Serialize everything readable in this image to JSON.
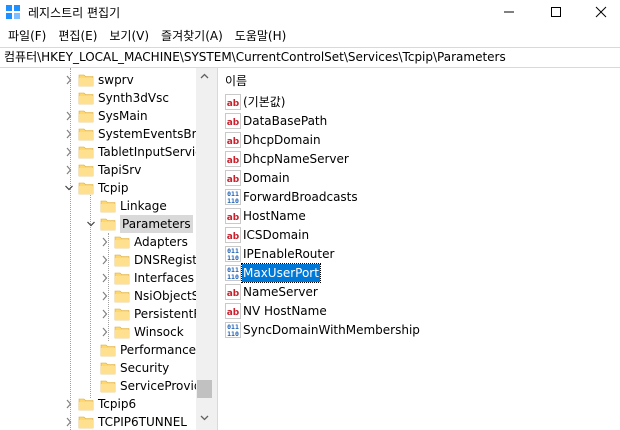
{
  "window": {
    "title": "레지스트리 편집기",
    "controls": [
      "minimize-icon",
      "maximize-icon",
      "close-icon"
    ]
  },
  "menu": [
    "파일(F)",
    "편집(E)",
    "보기(V)",
    "즐겨찾기(A)",
    "도움말(H)"
  ],
  "address": "컴퓨터\\HKEY_LOCAL_MACHINE\\SYSTEM\\CurrentControlSet\\Services\\Tcpip\\Parameters",
  "tree": {
    "items": [
      {
        "label": "swprv",
        "level": 1,
        "expander": "collapsed"
      },
      {
        "label": "Synth3dVsc",
        "level": 1,
        "expander": "none"
      },
      {
        "label": "SysMain",
        "level": 1,
        "expander": "collapsed"
      },
      {
        "label": "SystemEventsBrok",
        "level": 1,
        "expander": "collapsed"
      },
      {
        "label": "TabletInputService",
        "level": 1,
        "expander": "collapsed"
      },
      {
        "label": "TapiSrv",
        "level": 1,
        "expander": "collapsed"
      },
      {
        "label": "Tcpip",
        "level": 1,
        "expander": "expanded"
      },
      {
        "label": "Linkage",
        "level": 2,
        "expander": "none"
      },
      {
        "label": "Parameters",
        "level": 2,
        "expander": "expanded",
        "selected": true
      },
      {
        "label": "Adapters",
        "level": 3,
        "expander": "collapsed"
      },
      {
        "label": "DNSRegiste",
        "level": 3,
        "expander": "collapsed"
      },
      {
        "label": "Interfaces",
        "level": 3,
        "expander": "collapsed"
      },
      {
        "label": "NsiObjectSe",
        "level": 3,
        "expander": "collapsed"
      },
      {
        "label": "PersistentRo",
        "level": 3,
        "expander": "collapsed"
      },
      {
        "label": "Winsock",
        "level": 3,
        "expander": "collapsed"
      },
      {
        "label": "Performance",
        "level": 2,
        "expander": "none"
      },
      {
        "label": "Security",
        "level": 2,
        "expander": "none"
      },
      {
        "label": "ServiceProvider",
        "level": 2,
        "expander": "none"
      },
      {
        "label": "Tcpip6",
        "level": 1,
        "expander": "collapsed"
      },
      {
        "label": "TCPIP6TUNNEL",
        "level": 1,
        "expander": "collapsed"
      }
    ]
  },
  "values_pane": {
    "column_header": "이름",
    "items": [
      {
        "name": "(기본값)",
        "type": "string"
      },
      {
        "name": "DataBasePath",
        "type": "string"
      },
      {
        "name": "DhcpDomain",
        "type": "string"
      },
      {
        "name": "DhcpNameServer",
        "type": "string"
      },
      {
        "name": "Domain",
        "type": "string"
      },
      {
        "name": "ForwardBroadcasts",
        "type": "dword"
      },
      {
        "name": "HostName",
        "type": "string"
      },
      {
        "name": "ICSDomain",
        "type": "string"
      },
      {
        "name": "IPEnableRouter",
        "type": "dword"
      },
      {
        "name": "MaxUserPort",
        "type": "dword",
        "selected": true
      },
      {
        "name": "NameServer",
        "type": "string"
      },
      {
        "name": "NV HostName",
        "type": "string"
      },
      {
        "name": "SyncDomainWithMembership",
        "type": "dword"
      }
    ]
  },
  "colors": {
    "selection": "#0078d7",
    "tree_selection": "#d9d9d9",
    "folder": "#ffd76a",
    "string_icon_red": "#c8202c",
    "dword_icon_blue": "#1a5fb4"
  }
}
